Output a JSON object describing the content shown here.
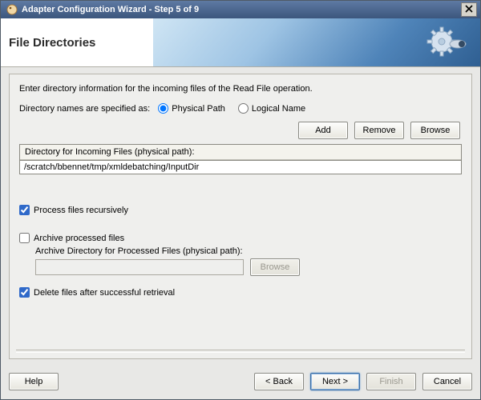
{
  "window": {
    "title": "Adapter Configuration Wizard - Step 5 of 9",
    "close_tooltip": "Close"
  },
  "banner": {
    "heading": "File Directories"
  },
  "content": {
    "intro": "Enter directory information for the incoming files of the Read File operation.",
    "spec_label": "Directory names are specified as:",
    "spec_options": {
      "physical": "Physical Path",
      "logical": "Logical Name",
      "selected": "physical"
    },
    "buttons": {
      "add": "Add",
      "remove": "Remove",
      "browse": "Browse"
    },
    "incoming": {
      "header": "Directory for Incoming Files (physical path):",
      "path": "/scratch/bbennet/tmp/xmldebatching/InputDir"
    },
    "process_recursively": {
      "label": "Process files recursively",
      "checked": true
    },
    "archive": {
      "label": "Archive processed files",
      "checked": false,
      "sublabel": "Archive Directory for Processed Files (physical path):",
      "path": "",
      "browse": "Browse"
    },
    "delete_after": {
      "label": "Delete files after successful retrieval",
      "checked": true
    }
  },
  "footer": {
    "help": "Help",
    "back": "< Back",
    "next": "Next >",
    "finish": "Finish",
    "cancel": "Cancel"
  }
}
